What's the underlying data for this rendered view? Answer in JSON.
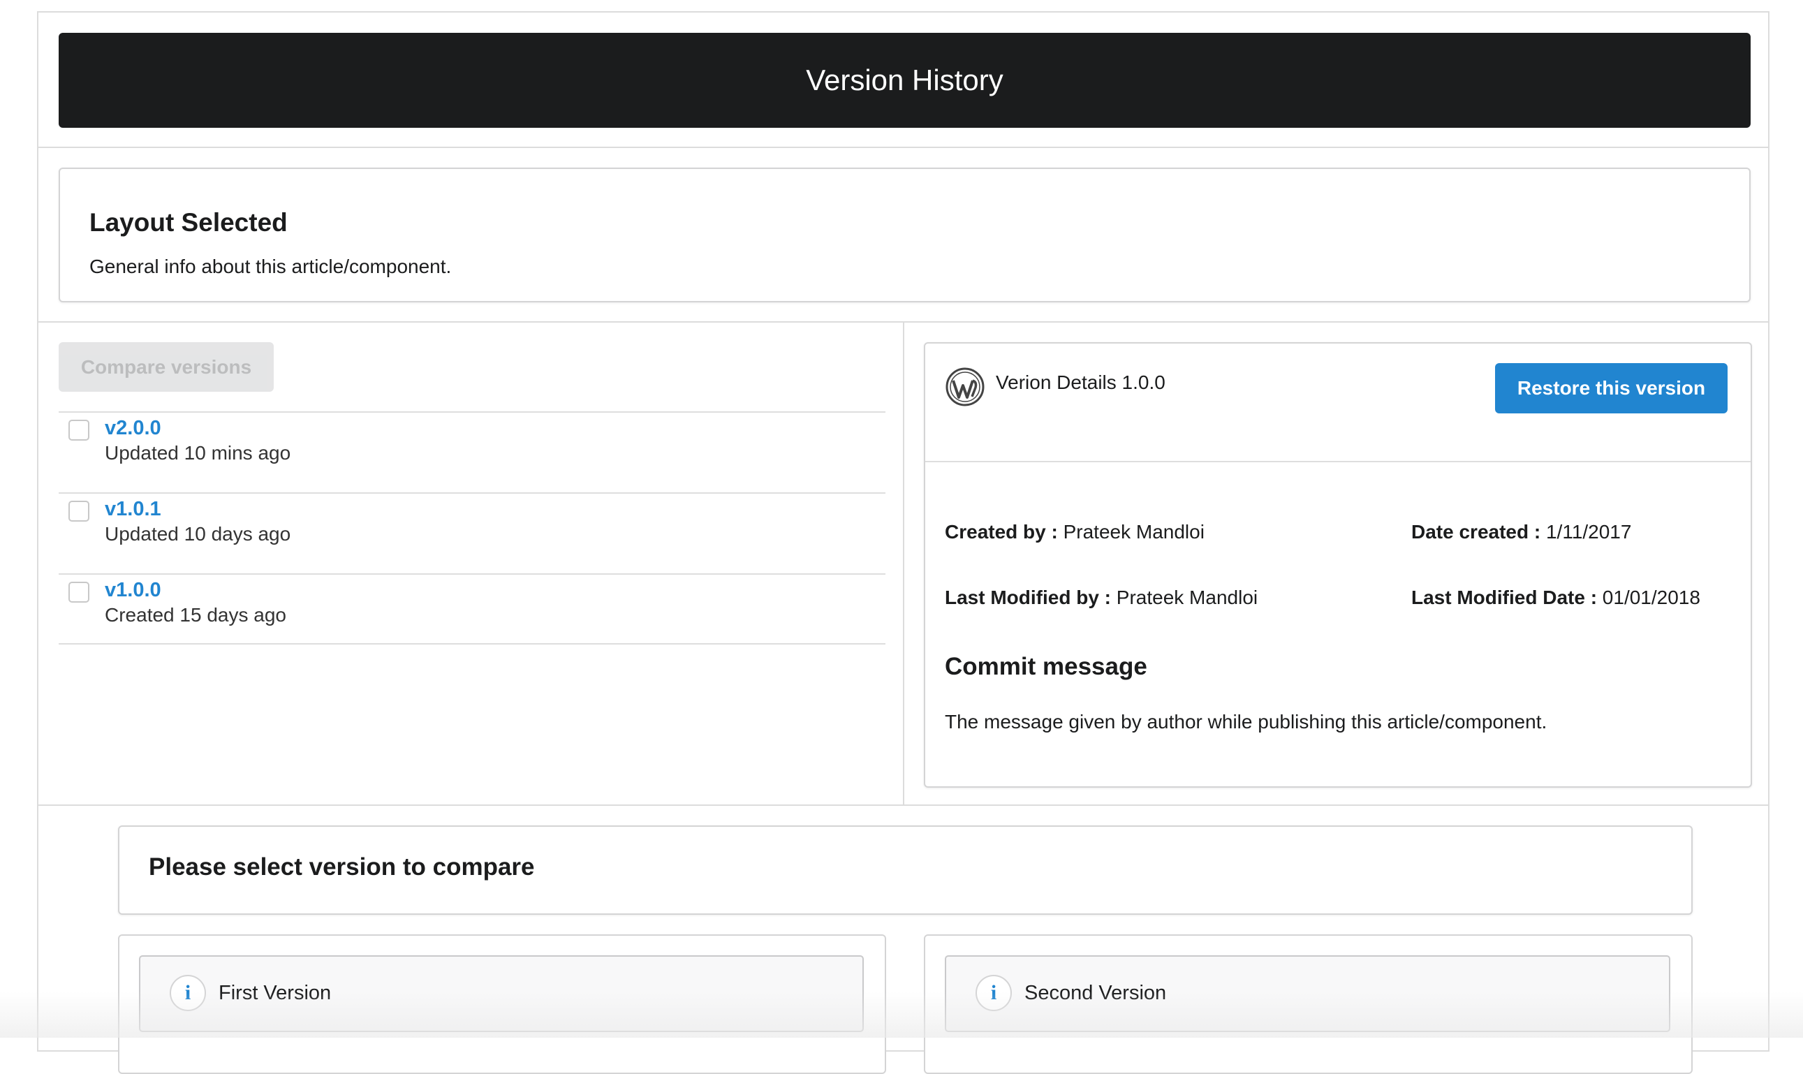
{
  "header": {
    "title": "Version History"
  },
  "layout": {
    "title": "Layout Selected",
    "description": "General info about this article/component."
  },
  "compare_button": {
    "label": "Compare versions",
    "enabled": false
  },
  "versions": [
    {
      "name": "v2.0.0",
      "meta": "Updated 10 mins ago",
      "checked": false
    },
    {
      "name": "v1.0.1",
      "meta": "Updated 10 days ago",
      "checked": false
    },
    {
      "name": "v1.0.0",
      "meta": "Created 15 days ago",
      "checked": false
    }
  ],
  "details": {
    "icon": "wordpress-icon",
    "title": "Verion Details 1.0.0",
    "restore_label": "Restore this version",
    "created_by_label": "Created by :",
    "created_by_value": "Prateek Mandloi",
    "date_created_label": "Date created :",
    "date_created_value": "1/11/2017",
    "last_modified_by_label": "Last Modified by :",
    "last_modified_by_value": "Prateek Mandloi",
    "last_modified_date_label": "Last Modified Date :",
    "last_modified_date_value": "01/01/2018",
    "commit_title": "Commit message",
    "commit_message": "The message given by author while publishing this article/component."
  },
  "compare_section": {
    "title": "Please select version to compare",
    "first_label": "First Version",
    "second_label": "Second Version",
    "info_icon": "info-icon"
  },
  "colors": {
    "header_bg": "#1b1c1d",
    "accent": "#2185d0",
    "disabled_button": "#e0e1e2"
  }
}
